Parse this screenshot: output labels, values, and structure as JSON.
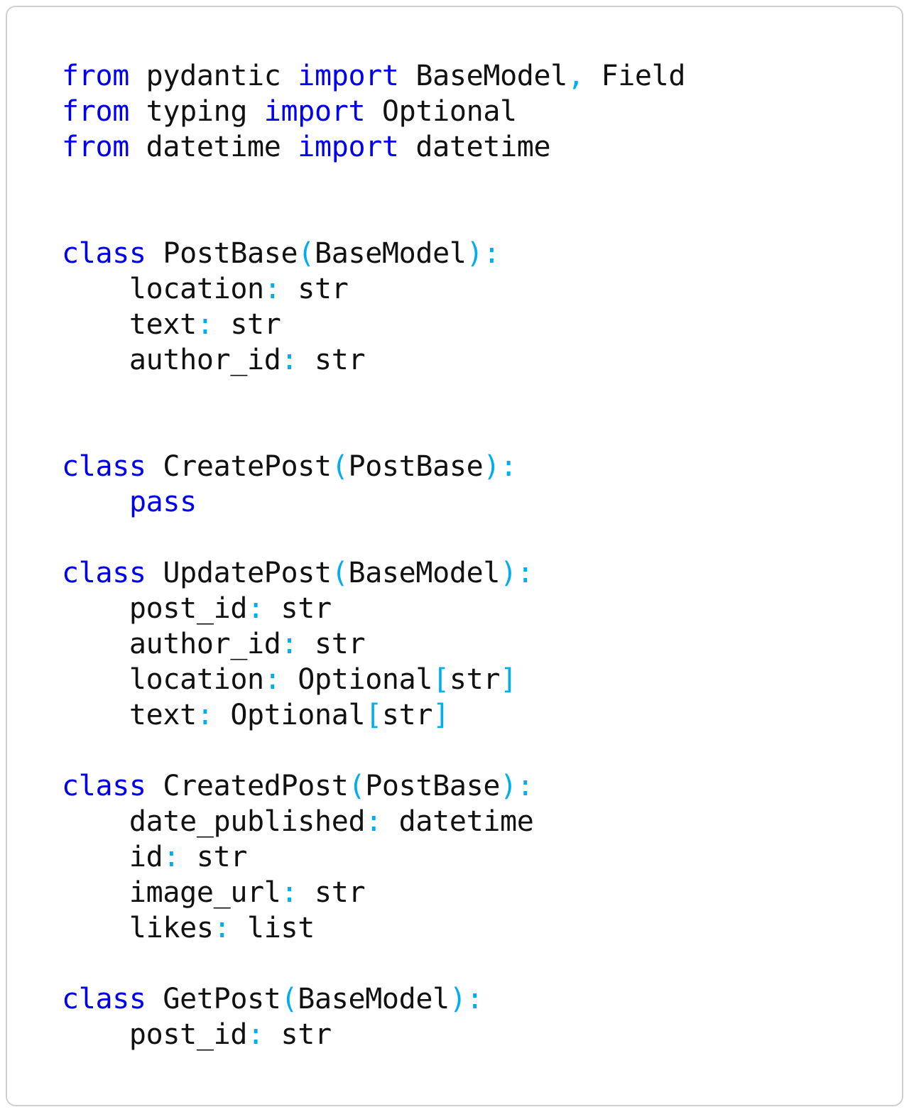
{
  "card": {
    "background": "#ffffff",
    "border_color": "#cfcfcf",
    "corner_radius": "14px"
  },
  "theme": {
    "keyword_color": "#0000ee",
    "punctuation_color": "#00aeef",
    "text_color": "#111111",
    "background_color": "#ffffff",
    "font_size": "40px",
    "line_height": "50px"
  },
  "code": {
    "language": "python",
    "full_text": "from pydantic import BaseModel, Field\nfrom typing import Optional\nfrom datetime import datetime\n\n\nclass PostBase(BaseModel):\n    location: str\n    text: str\n    author_id: str\n\n\nclass CreatePost(PostBase):\n    pass\n\nclass UpdatePost(BaseModel):\n    post_id: str\n    author_id: str\n    location: Optional[str]\n    text: Optional[str]\n\nclass CreatedPost(PostBase):\n    date_published: datetime\n    id: str\n    image_url: str\n    likes: list\n\nclass GetPost(BaseModel):\n    post_id: str",
    "lines": [
      {
        "n": 1,
        "tokens": [
          {
            "t": "from",
            "c": "kw"
          },
          {
            "t": " pydantic ",
            "c": "id"
          },
          {
            "t": "import",
            "c": "kw"
          },
          {
            "t": " BaseModel",
            "c": "id"
          },
          {
            "t": ",",
            "c": "pun"
          },
          {
            "t": " Field",
            "c": "id"
          }
        ]
      },
      {
        "n": 2,
        "tokens": [
          {
            "t": "from",
            "c": "kw"
          },
          {
            "t": " typing ",
            "c": "id"
          },
          {
            "t": "import",
            "c": "kw"
          },
          {
            "t": " Optional",
            "c": "id"
          }
        ]
      },
      {
        "n": 3,
        "tokens": [
          {
            "t": "from",
            "c": "kw"
          },
          {
            "t": " datetime ",
            "c": "id"
          },
          {
            "t": "import",
            "c": "kw"
          },
          {
            "t": " datetime",
            "c": "id"
          }
        ]
      },
      {
        "n": 4,
        "tokens": []
      },
      {
        "n": 5,
        "tokens": []
      },
      {
        "n": 6,
        "tokens": [
          {
            "t": "class",
            "c": "kw"
          },
          {
            "t": " PostBase",
            "c": "id"
          },
          {
            "t": "(",
            "c": "pun"
          },
          {
            "t": "BaseModel",
            "c": "id"
          },
          {
            "t": ")",
            "c": "pun"
          },
          {
            "t": ":",
            "c": "pun"
          }
        ]
      },
      {
        "n": 7,
        "tokens": [
          {
            "t": "    location",
            "c": "id"
          },
          {
            "t": ":",
            "c": "pun"
          },
          {
            "t": " str",
            "c": "id"
          }
        ]
      },
      {
        "n": 8,
        "tokens": [
          {
            "t": "    text",
            "c": "id"
          },
          {
            "t": ":",
            "c": "pun"
          },
          {
            "t": " str",
            "c": "id"
          }
        ]
      },
      {
        "n": 9,
        "tokens": [
          {
            "t": "    author_id",
            "c": "id"
          },
          {
            "t": ":",
            "c": "pun"
          },
          {
            "t": " str",
            "c": "id"
          }
        ]
      },
      {
        "n": 10,
        "tokens": []
      },
      {
        "n": 11,
        "tokens": []
      },
      {
        "n": 12,
        "tokens": [
          {
            "t": "class",
            "c": "kw"
          },
          {
            "t": " CreatePost",
            "c": "id"
          },
          {
            "t": "(",
            "c": "pun"
          },
          {
            "t": "PostBase",
            "c": "id"
          },
          {
            "t": ")",
            "c": "pun"
          },
          {
            "t": ":",
            "c": "pun"
          }
        ]
      },
      {
        "n": 13,
        "tokens": [
          {
            "t": "    ",
            "c": "id"
          },
          {
            "t": "pass",
            "c": "kw"
          }
        ]
      },
      {
        "n": 14,
        "tokens": []
      },
      {
        "n": 15,
        "tokens": [
          {
            "t": "class",
            "c": "kw"
          },
          {
            "t": " UpdatePost",
            "c": "id"
          },
          {
            "t": "(",
            "c": "pun"
          },
          {
            "t": "BaseModel",
            "c": "id"
          },
          {
            "t": ")",
            "c": "pun"
          },
          {
            "t": ":",
            "c": "pun"
          }
        ]
      },
      {
        "n": 16,
        "tokens": [
          {
            "t": "    post_id",
            "c": "id"
          },
          {
            "t": ":",
            "c": "pun"
          },
          {
            "t": " str",
            "c": "id"
          }
        ]
      },
      {
        "n": 17,
        "tokens": [
          {
            "t": "    author_id",
            "c": "id"
          },
          {
            "t": ":",
            "c": "pun"
          },
          {
            "t": " str",
            "c": "id"
          }
        ]
      },
      {
        "n": 18,
        "tokens": [
          {
            "t": "    location",
            "c": "id"
          },
          {
            "t": ":",
            "c": "pun"
          },
          {
            "t": " Optional",
            "c": "id"
          },
          {
            "t": "[",
            "c": "pun"
          },
          {
            "t": "str",
            "c": "id"
          },
          {
            "t": "]",
            "c": "pun"
          }
        ]
      },
      {
        "n": 19,
        "tokens": [
          {
            "t": "    text",
            "c": "id"
          },
          {
            "t": ":",
            "c": "pun"
          },
          {
            "t": " Optional",
            "c": "id"
          },
          {
            "t": "[",
            "c": "pun"
          },
          {
            "t": "str",
            "c": "id"
          },
          {
            "t": "]",
            "c": "pun"
          }
        ]
      },
      {
        "n": 20,
        "tokens": []
      },
      {
        "n": 21,
        "tokens": [
          {
            "t": "class",
            "c": "kw"
          },
          {
            "t": " CreatedPost",
            "c": "id"
          },
          {
            "t": "(",
            "c": "pun"
          },
          {
            "t": "PostBase",
            "c": "id"
          },
          {
            "t": ")",
            "c": "pun"
          },
          {
            "t": ":",
            "c": "pun"
          }
        ]
      },
      {
        "n": 22,
        "tokens": [
          {
            "t": "    date_published",
            "c": "id"
          },
          {
            "t": ":",
            "c": "pun"
          },
          {
            "t": " datetime",
            "c": "id"
          }
        ]
      },
      {
        "n": 23,
        "tokens": [
          {
            "t": "    id",
            "c": "id"
          },
          {
            "t": ":",
            "c": "pun"
          },
          {
            "t": " str",
            "c": "id"
          }
        ]
      },
      {
        "n": 24,
        "tokens": [
          {
            "t": "    image_url",
            "c": "id"
          },
          {
            "t": ":",
            "c": "pun"
          },
          {
            "t": " str",
            "c": "id"
          }
        ]
      },
      {
        "n": 25,
        "tokens": [
          {
            "t": "    likes",
            "c": "id"
          },
          {
            "t": ":",
            "c": "pun"
          },
          {
            "t": " list",
            "c": "id"
          }
        ]
      },
      {
        "n": 26,
        "tokens": []
      },
      {
        "n": 27,
        "tokens": [
          {
            "t": "class",
            "c": "kw"
          },
          {
            "t": " GetPost",
            "c": "id"
          },
          {
            "t": "(",
            "c": "pun"
          },
          {
            "t": "BaseModel",
            "c": "id"
          },
          {
            "t": ")",
            "c": "pun"
          },
          {
            "t": ":",
            "c": "pun"
          }
        ]
      },
      {
        "n": 28,
        "tokens": [
          {
            "t": "    post_id",
            "c": "id"
          },
          {
            "t": ":",
            "c": "pun"
          },
          {
            "t": " str",
            "c": "id"
          }
        ]
      }
    ]
  }
}
